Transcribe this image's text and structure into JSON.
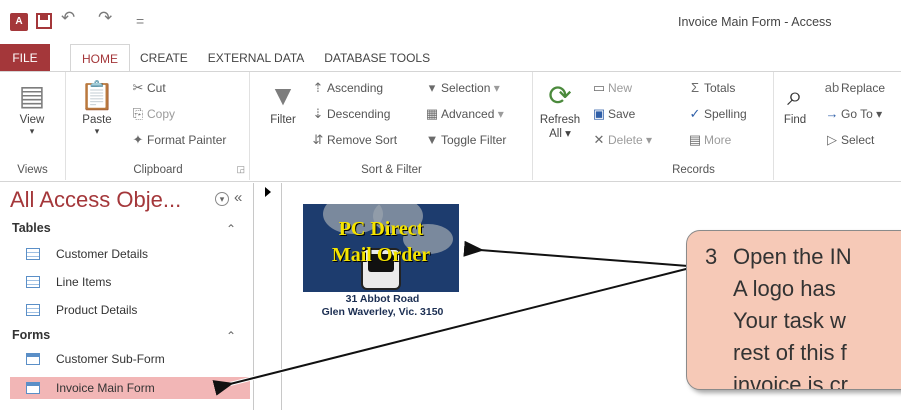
{
  "window": {
    "title": "Invoice Main Form - Access"
  },
  "qat": {
    "app_icon": "A",
    "redo_glyph": "↷"
  },
  "tabs": [
    "FILE",
    "HOME",
    "CREATE",
    "EXTERNAL DATA",
    "DATABASE TOOLS"
  ],
  "ribbon": {
    "views": {
      "view_label": "View",
      "group_label": "Views"
    },
    "clipboard": {
      "paste_label": "Paste",
      "cut_label": "Cut",
      "copy_label": "Copy",
      "format_painter_label": "Format Painter",
      "group_label": "Clipboard"
    },
    "sort_filter": {
      "filter_label": "Filter",
      "ascending_label": "Ascending",
      "descending_label": "Descending",
      "remove_sort_label": "Remove Sort",
      "selection_label": "Selection",
      "advanced_label": "Advanced",
      "toggle_filter_label": "Toggle Filter",
      "group_label": "Sort & Filter"
    },
    "records": {
      "refresh_label": "Refresh",
      "refresh_sub": "All",
      "new_label": "New",
      "save_label": "Save",
      "delete_label": "Delete",
      "totals_label": "Totals",
      "spelling_label": "Spelling",
      "more_label": "More",
      "group_label": "Records"
    },
    "find": {
      "find_label": "Find",
      "replace_label": "Replace",
      "goto_label": "Go To",
      "select_label": "Select"
    }
  },
  "nav": {
    "header": "All Access Obje...",
    "sections": [
      {
        "title": "Tables",
        "items": [
          "Customer Details",
          "Line Items",
          "Product Details"
        ]
      },
      {
        "title": "Forms",
        "items": [
          "Customer Sub-Form",
          "Invoice Main Form"
        ]
      }
    ],
    "selected_item": "Invoice Main Form"
  },
  "form": {
    "logo_line1": "PC Direct",
    "logo_line2": "Mail Order",
    "address_line1": "31 Abbot Road",
    "address_line2": "Glen Waverley, Vic. 3150"
  },
  "callout": {
    "step": "3",
    "lines": [
      "Open the IN",
      "A logo has",
      "Your task w",
      "rest of this f",
      "invoice is cr"
    ]
  },
  "colors": {
    "access_red": "#a4373a",
    "callout_fill": "#f6c9b7",
    "selected_nav": "#f2b6b6"
  }
}
